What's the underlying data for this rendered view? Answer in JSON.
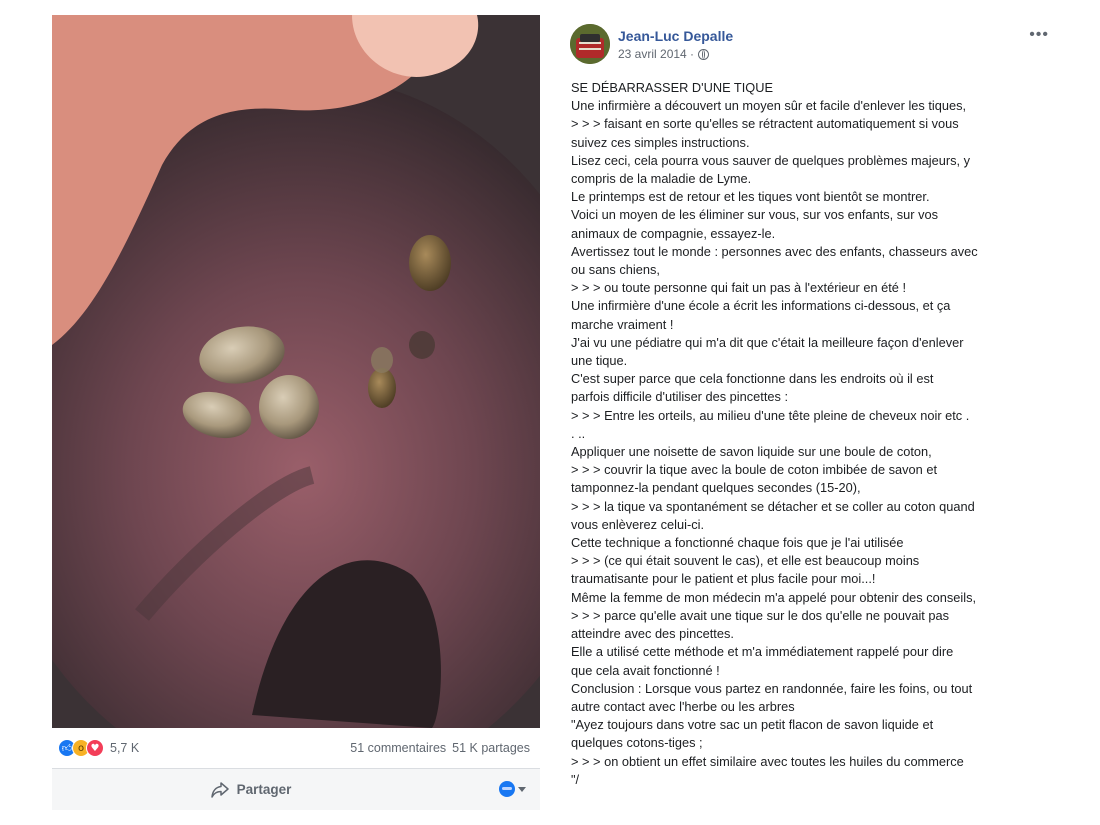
{
  "left_card": {
    "stats": {
      "reaction_count": "5,7 K",
      "comments": "51 commentaires",
      "shares": "51 K partages"
    },
    "actions": {
      "share_label": "Partager"
    }
  },
  "post": {
    "author": "Jean-Luc Depalle",
    "date": "23 avril 2014 · ",
    "lines": [
      "SE DÉBARRASSER D'UNE TIQUE",
      "Une infirmière a découvert un moyen sûr et facile d'enlever les tiques,",
      "> > > faisant en sorte qu'elles se rétractent automatiquement si vous",
      "suivez ces simples instructions.",
      "Lisez ceci, cela pourra vous sauver de quelques problèmes majeurs, y",
      "compris de la maladie de Lyme.",
      "Le printemps est de retour et les tiques vont bientôt se montrer.",
      "Voici un moyen de les éliminer sur vous, sur vos enfants, sur vos",
      "animaux de compagnie, essayez-le.",
      "Avertissez tout le monde : personnes avec des enfants, chasseurs avec",
      "ou sans chiens,",
      "> > > ou toute personne qui fait un pas à l'extérieur en été !",
      "Une infirmière d'une école a écrit les informations ci-dessous, et ça",
      "marche vraiment !",
      "J'ai vu une pédiatre qui m'a dit que c'était la meilleure façon d'enlever",
      "une tique.",
      "C'est super parce que cela fonctionne dans les endroits où il est",
      "parfois difficile d'utiliser des pincettes :",
      "> > > Entre les orteils, au milieu d'une tête pleine de cheveux noir etc .",
      ". ..",
      "Appliquer une noisette de savon liquide sur une boule de coton,",
      "> > > couvrir la tique avec la boule de coton imbibée de savon et",
      "tamponnez-la pendant quelques secondes (15-20),",
      "> > > la tique va spontanément se détacher et se coller au coton quand",
      "vous enlèverez celui-ci.",
      "Cette technique a fonctionné chaque fois que je l'ai utilisée",
      "> > > (ce qui était souvent le cas), et elle est beaucoup moins",
      "traumatisante pour le patient et plus facile pour moi...!",
      "Même la femme de mon médecin m'a appelé pour obtenir des conseils,",
      "> > > parce qu'elle avait une tique sur le dos qu'elle ne pouvait pas",
      "atteindre avec des pincettes.",
      "Elle a utilisé cette méthode et m'a immédiatement rappelé pour dire",
      "que cela avait fonctionné !",
      "Conclusion : Lorsque vous partez en randonnée, faire les foins, ou tout",
      "autre contact avec l'herbe ou les arbres",
      "\"Ayez toujours dans votre sac un petit flacon de savon liquide et",
      "quelques cotons-tiges ;",
      "> > > on obtient un effet similaire avec toutes les huiles du commerce",
      "\"/"
    ]
  },
  "colors": {
    "author_link": "#365899",
    "meta_gray": "#606770",
    "like_blue": "#1877f2",
    "love_red": "#f33e58",
    "wow_yellow": "#f7b125"
  },
  "icons": [
    "like-reaction-icon",
    "wow-reaction-icon",
    "love-reaction-icon",
    "share-arrow-icon",
    "globe-icon",
    "more-dots-icon",
    "audience-selector-icon"
  ]
}
